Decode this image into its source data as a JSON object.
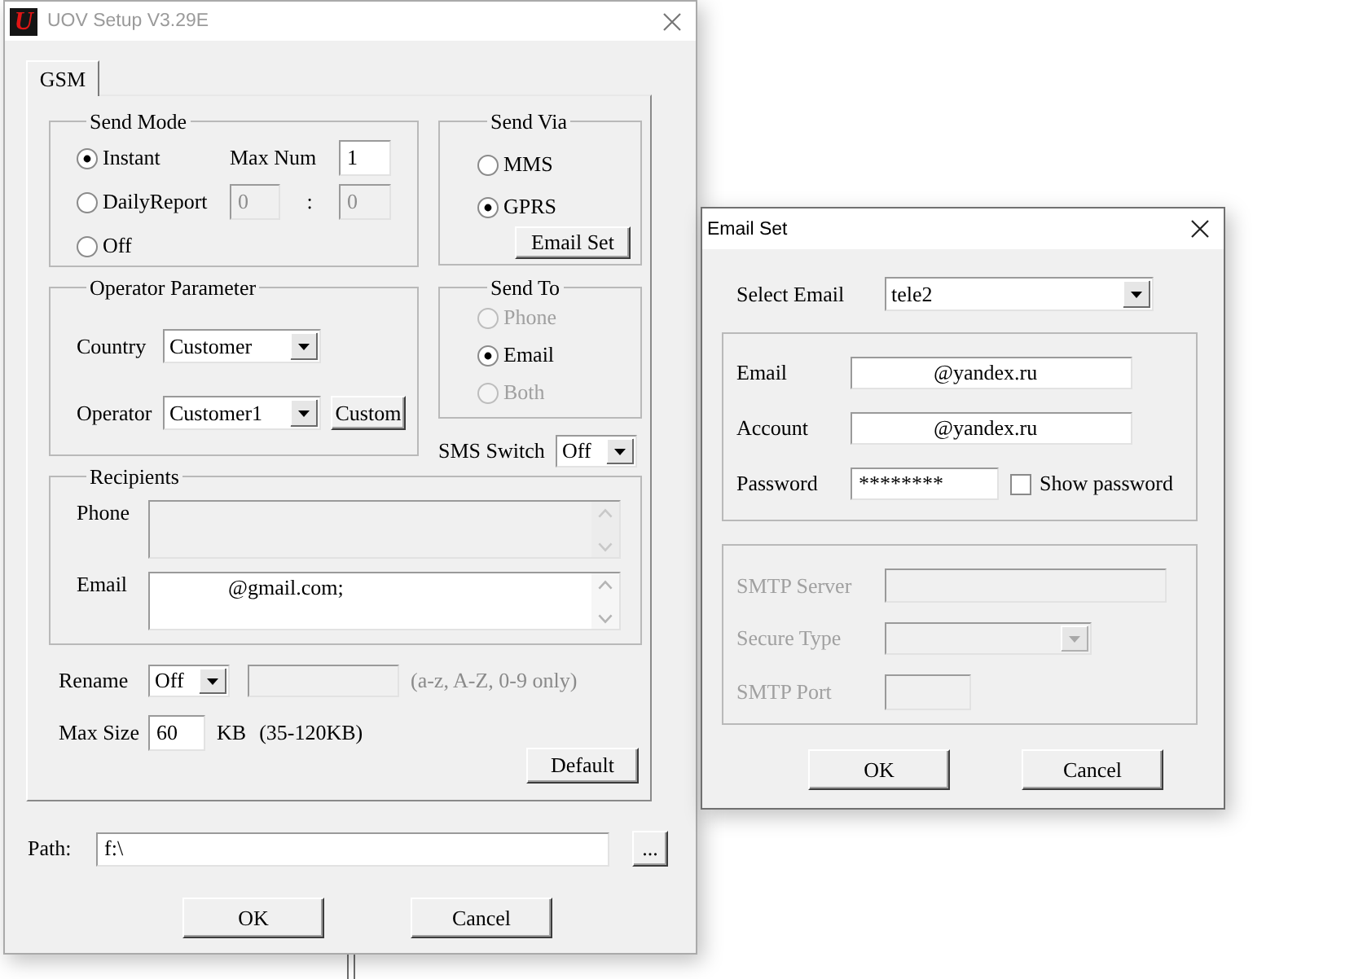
{
  "main_window": {
    "title": "UOV Setup V3.29E",
    "logo_text": "U",
    "active": false
  },
  "tabs": [
    {
      "label": "GSM",
      "selected": true
    }
  ],
  "send_mode": {
    "title": "Send Mode",
    "options": [
      {
        "label": "Instant",
        "selected": true
      },
      {
        "label": "DailyReport",
        "selected": false
      },
      {
        "label": "Off",
        "selected": false
      }
    ],
    "max_num": {
      "label": "Max Num",
      "value": "1",
      "disabled": false
    },
    "daily_from": {
      "value": "0",
      "disabled": true
    },
    "daily_separator": ":",
    "daily_to": {
      "value": "0",
      "disabled": true
    }
  },
  "send_via": {
    "title": "Send Via",
    "options": [
      {
        "label": "MMS",
        "selected": false
      },
      {
        "label": "GPRS",
        "selected": true
      }
    ],
    "email_set_button": "Email Set"
  },
  "operator_parameter": {
    "title": "Operator Parameter",
    "country": {
      "label": "Country",
      "value": "Customer"
    },
    "operator": {
      "label": "Operator",
      "value": "Customer1"
    },
    "custom_button": "Custom"
  },
  "send_to": {
    "title": "Send To",
    "options": [
      {
        "label": "Phone",
        "selected": false,
        "disabled": true
      },
      {
        "label": "Email",
        "selected": true,
        "disabled": false
      },
      {
        "label": "Both",
        "selected": false,
        "disabled": true
      }
    ]
  },
  "sms_switch": {
    "label": "SMS Switch",
    "value": "Off"
  },
  "recipients": {
    "title": "Recipients",
    "phone": {
      "label": "Phone",
      "disabled": true
    },
    "email": {
      "label": "Email",
      "value": "@gmail.com;",
      "disabled": false
    }
  },
  "rename": {
    "label": "Rename",
    "value": "Off",
    "name_field": {
      "disabled": true
    },
    "hint": "(a-z, A-Z, 0-9 only)"
  },
  "max_size": {
    "label": "Max Size",
    "value": "60",
    "unit": "KB",
    "range": "(35-120KB)"
  },
  "default_button": "Default",
  "path": {
    "label": "Path:",
    "value": "f:\\",
    "browse_button": "..."
  },
  "buttons": [
    "OK",
    "Cancel"
  ],
  "email_set_window": {
    "title": "Email Set",
    "active": true,
    "select_email": {
      "label": "Select Email",
      "value": "tele2"
    },
    "fields": [
      {
        "kind": "text",
        "label": "Email",
        "value": "@yandex.ru"
      },
      {
        "kind": "text",
        "label": "Account",
        "value": "@yandex.ru"
      },
      {
        "kind": "password",
        "label": "Password",
        "value": "********"
      }
    ],
    "show_password": {
      "label": "Show password",
      "checked": false
    },
    "smtp": {
      "disabled": true,
      "fields": [
        {
          "kind": "text",
          "label": "SMTP Server"
        },
        {
          "kind": "dropdown",
          "label": "Secure Type"
        },
        {
          "kind": "port",
          "label": "SMTP Port"
        }
      ]
    },
    "buttons": [
      "OK",
      "Cancel"
    ]
  }
}
